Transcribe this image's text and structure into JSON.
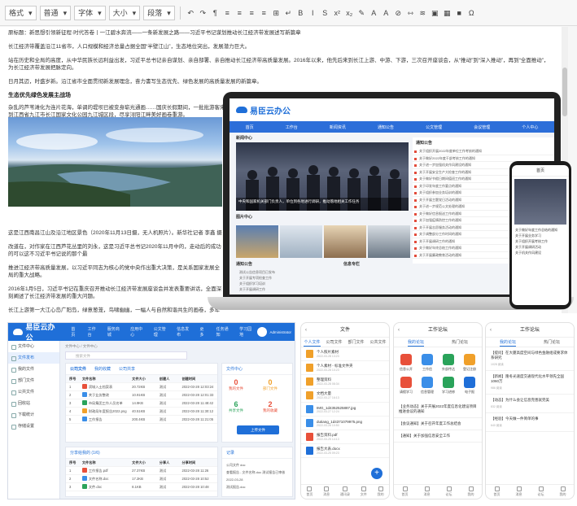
{
  "editor": {
    "toolbar": {
      "format_select": "格式",
      "style_select": "普通",
      "font_select": "字体",
      "size_select": "大小",
      "heading_select": "段落",
      "buttons": [
        "↶",
        "↷",
        "¶",
        "≡",
        "≡",
        "≡",
        "≡",
        "⊞",
        "↵",
        "B",
        "I",
        "S",
        "x²",
        "x₂",
        "✎",
        "A",
        "A",
        "⊘",
        "⇿",
        "≋",
        "▣",
        "▦",
        "■",
        "Ω"
      ]
    },
    "paragraphs": [
      "原标题：新思想引领新征程·时代答卷丨一江碧水奔流——一条新发展之路——习近平书记谋划推动长江经济带发展述写新篇章",
      "长江经济带覆盖沿江11省市，人口规模和经济总量占据全国“半壁江山”，生态地位突出，发展潜力巨大。",
      "站在历史和全局的高度，从中华民族长远利益出发，习近平总书记亲自谋划、亲自部署、亲自推动长江经济带高质量发展。2016年以来，他先后来到长江上游、中游、下游，三次召开座谈会，从“推动”到“深入推动”，再到“全面推动”，为长江经济带发展把脉定向。",
      "日月其迈，时盛岁新。沿江省市全面贯彻新发展理念，奋力書写生态优先、绿色发展的高质量发展的新篇章。"
    ],
    "heading": "生态优先绿色发展主战场",
    "paragraph_after_heading": "杂乱的芦苇滩化为连片花海，单调的堤坝已被变身崭光通画……国庆长假期间，一批批游客来到江西省九江市长江国家文化公园九江城区段，尽享浔阳江畔美好画卷重游。",
    "caption": "这是江西南昌江山及沿江地区景色（2020年11月13日摄，无人机照片）。新华社记者 李鑫 摄",
    "lower_paragraphs": [
      "改道在，对作家在江西芦花丛里的刘永，这是习近平总书记2020年11月中的，走动后的成功的可以这不习近平书记说的那个最",
      "2016年1月5日，习近平书记在重庆召开推动长江经济带发展座谈会并发表重要讲话，全面深刻阐述了长江经济带发展的重大问题。",
      "长江上游第一大江心岛广阳岛，绿意葱茏，鸟啸幽幽，一幅人与自然和谐共生的画卷，多年前，这里"
    ],
    "text_fragments": [
      "推进江经济带高质量发展，以习近平同志为核心的党中央作出重大决策，是关系国家发展全局的重大战略。"
    ]
  },
  "laptop": {
    "logo": "易臣云办公",
    "nav": [
      "首页",
      "工作台",
      "新闻资讯",
      "通知公告",
      "公文管理",
      "会议管理",
      "个人中心"
    ],
    "news_caption": "中央和国家机关部门负责人，单位到各地进行调研，推动落地相关工作任务",
    "news_title": "新闻中心",
    "gallery_title": "图片中心",
    "notice_title": "通知公告",
    "info_title": "信息专栏",
    "side_title": "通知公告",
    "side_rows": [
      "关于组织开展2022年度单位工作考核的通知",
      "关于做好2022年度干部考核工作的通知",
      "关于进一步加强机关作风建设的通知",
      "关于开展安全生产大检查工作的通知",
      "关于做好节假日期间值班工作的通知",
      "关于印发年度工作要点的通知",
      "关于组织参加业务培训的通知",
      "关于开展主题党日活动的通知",
      "关于进一步规范公文处理的通知",
      "关于做好信息报送工作的通知",
      "关于加强疫情防控工作的通知",
      "关于开展志愿服务活动的通知",
      "关于调整部分工作时间的通知",
      "关于开展调研工作的通知",
      "关于做好年终总结工作的通知",
      "关于开展廉政教育活动的通知"
    ],
    "list_rows": [
      "测试公告信息项目已发布",
      "关于开展专项检查工作",
      "关于组织学习培训",
      "关于开展调研工作"
    ]
  },
  "phone_big": {
    "title": "首页",
    "news": [
      "关于做好年度工作总结的通知",
      "关于开展业务学习",
      "关于组织开展考核工作",
      "关于开展调研活动",
      "关于机关作风建设"
    ]
  },
  "app": {
    "logo": "易臣云办公",
    "tabs": [
      "首页",
      "工作台",
      "服务商城",
      "应用中心",
      "公文管理",
      "信息发布",
      "更多",
      "任务通知",
      "学习园地"
    ],
    "user": "Administrator",
    "sidebar": [
      "文件中心",
      "文件发布",
      "我的文件",
      "部门文件",
      "公共文件",
      "回收站",
      "下载统计",
      "存储设置"
    ],
    "breadcrumb": "文件中心 / 文件中心",
    "search_placeholder": "搜索文件",
    "tabs_inner": [
      "公司文件",
      "我的收藏",
      "公司共享"
    ],
    "table_title": "文件列表",
    "cols": [
      "序号",
      "文件名称",
      "文件大小",
      "创建人",
      "创建时间"
    ],
    "rows": [
      [
        "1",
        "滨城入土档案表",
        "20.72KB",
        "测试",
        "2022-03-28 12:03:24"
      ],
      [
        "2",
        "关于业务整改",
        "10.91KB",
        "测试",
        "2022-03-28 12:01:33"
      ],
      [
        "3",
        "市局集团工作人员名单",
        "14.9KB",
        "测试",
        "2022-03-28 11:48:42"
      ],
      [
        "4",
        "财政局年度报告2022.png",
        "40.51KB",
        "测试",
        "2022-03-28 11:30:12"
      ],
      [
        "5",
        "工作报告",
        "200.4KB",
        "测试",
        "2022-03-28 11:21:05"
      ]
    ],
    "stats_title": "文件中心",
    "stats": [
      [
        "0",
        "我的文件"
      ],
      [
        "0",
        "部门文件"
      ],
      [
        "6",
        "共享文件"
      ],
      [
        "2",
        "我的收藏"
      ]
    ],
    "upload_button": "上传文件",
    "share_title": "分享给我的 (1/6)",
    "share_cols": [
      "序号",
      "文件名称",
      "文件大小",
      "分享人",
      "分享时间"
    ],
    "share_rows": [
      [
        "1",
        "工作报告.pdf",
        "27.37KB",
        "测试",
        "2022-03-28 11:26"
      ],
      [
        "2",
        "文件名称.doc",
        "17.2KB",
        "测试",
        "2022-03-28 10:52"
      ],
      [
        "3",
        "文件.doc",
        "8.1KB",
        "测试",
        "2022-03-28 10:48"
      ]
    ],
    "log_title": "记录",
    "logs": [
      "公司文件 doc",
      "查看报告 - 文件名称.doc 测试报告已审核2022-03-28",
      "测试报告.doc"
    ]
  },
  "phone_files": {
    "title": "文件",
    "tabs": [
      "个人文件",
      "公司文件",
      "部门文件",
      "公共文件"
    ],
    "files": [
      [
        "个人照片素材",
        "2022-03-28 13:23"
      ],
      [
        "个人素材 - 标准文件夹",
        "2022-03-28 10:23"
      ],
      [
        "整理资料",
        "2022-03-28 08:34"
      ],
      [
        "文档大量",
        "2022-03-27 16:13"
      ],
      [
        "IMG_1d4352525887.jpg",
        "2022-03-27 12:24"
      ],
      [
        "dutiang_1d4371079975.png",
        "2022-03-26 10:50"
      ],
      [
        "报告资料.pdf",
        "2022-03-25 14:13"
      ],
      [
        "报告大表.docx",
        "2022-03-25 09:23"
      ]
    ],
    "bottom": [
      "首页",
      "消息",
      "通讯录",
      "文件",
      "我的"
    ]
  },
  "phone_forum1": {
    "title": "工作论坛",
    "tabs": [
      "我的论坛",
      "热门论坛"
    ],
    "grid": [
      [
        "#e8503a",
        "信息公开"
      ],
      [
        "#3a8ee8",
        "工作信"
      ],
      [
        "#2aa35a",
        "外部传达"
      ],
      [
        "#f0a02a",
        "登记注册"
      ],
      [
        "#e8503a",
        "请假学习"
      ],
      [
        "#3a8ee8",
        "信息管理"
      ],
      [
        "#2aa35a",
        "学习进修"
      ],
      [
        "#1f6fd8",
        "电子报"
      ]
    ],
    "news": [
      "【业务动态】关于开展2022年度信息化建设项目推进会议的通知",
      "【会议通知】关于召开年度工作总结会",
      "【通知】关于加强信息安全工作"
    ],
    "bottom": [
      "首页",
      "消息",
      "论坛",
      "我的"
    ]
  },
  "phone_forum2": {
    "title": "工作论坛",
    "tabs": [
      "我的论坛",
      "热门论坛"
    ],
    "items": [
      [
        "【提问】在大厦高度空间与绿色金融组成要求体系研究",
        "1028 阅读"
      ],
      [
        "【新闻】隆冬光速度交通现代化水平领先全国1060万",
        "986 阅读"
      ],
      [
        "【动态】为什么会让信息完善就完美",
        "832 阅读"
      ],
      [
        "【经验】今天做一件简单的事",
        "640 阅读"
      ]
    ],
    "bottom": [
      "首页",
      "消息",
      "论坛",
      "我的"
    ]
  }
}
